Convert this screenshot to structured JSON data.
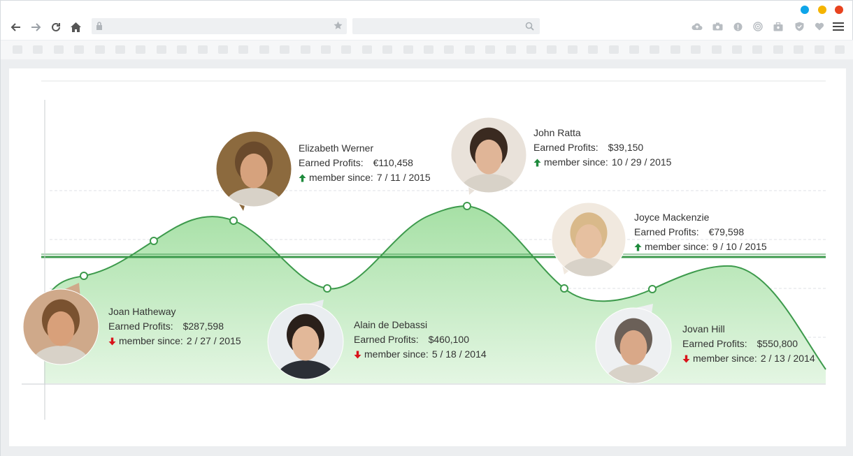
{
  "colors": {
    "accent_blue": "#0ea5e9",
    "accent_yellow": "#f5b400",
    "accent_red": "#e8431f",
    "curve": "#3d9a4c",
    "fill": "#b6e6b5",
    "up": "#1e8a3c",
    "down": "#d9141b"
  },
  "toolbar": {
    "back_icon": "arrow-left",
    "forward_icon": "arrow-right",
    "reload_icon": "reload",
    "home_icon": "home"
  },
  "members": [
    {
      "name": "Joan Hatheway",
      "profit_label": "Earned Profits:",
      "profit": "$287,598",
      "since_label": "member since:",
      "since": "2 / 27 / 2015",
      "trend": "down",
      "skin": "#d8a07a",
      "hair": "#7a5230",
      "bg": "#cfa98a"
    },
    {
      "name": "Elizabeth Werner",
      "profit_label": "Earned Profits:",
      "profit": "€110,458",
      "since_label": "member since:",
      "since": "7 / 11 / 2015",
      "trend": "up",
      "skin": "#d6a27d",
      "hair": "#6a4a2c",
      "bg": "#8c6a3e"
    },
    {
      "name": "Alain de Debassi",
      "profit_label": "Earned Profits:",
      "profit": "$460,100",
      "since_label": "member since:",
      "since": "5 / 18 / 2014",
      "trend": "down",
      "skin": "#e2b899",
      "hair": "#2a201a",
      "bg": "#e9edf0"
    },
    {
      "name": "John Ratta",
      "profit_label": "Earned Profits:",
      "profit": "$39,150",
      "since_label": "member since:",
      "since": "10 / 29 / 2015",
      "trend": "up",
      "skin": "#e0b597",
      "hair": "#3a2a20",
      "bg": "#e9e2da"
    },
    {
      "name": "Joyce Mackenzie",
      "profit_label": "Earned Profits:",
      "profit": "€79,598",
      "since_label": "member since:",
      "since": "9 / 10 / 2015",
      "trend": "up",
      "skin": "#e6c0a0",
      "hair": "#d9b98a",
      "bg": "#f1e9df"
    },
    {
      "name": "Jovan Hill",
      "profit_label": "Earned Profits:",
      "profit": "$550,800",
      "since_label": "member since:",
      "since": "2 / 13 / 2014",
      "trend": "down",
      "skin": "#d9a888",
      "hair": "#6b6058",
      "bg": "#eef0f2"
    }
  ]
}
